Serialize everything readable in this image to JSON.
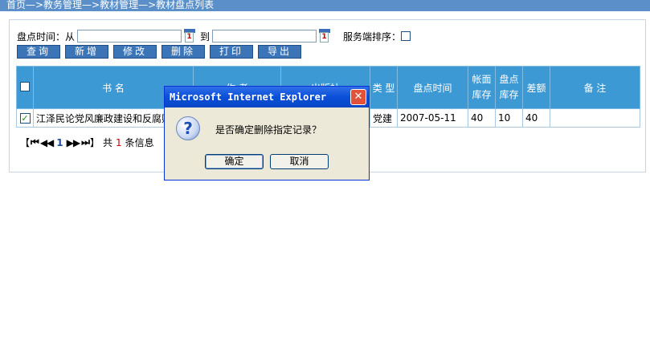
{
  "breadcrumb": "首页—>教务管理—>教材管理—>教材盘点列表",
  "search": {
    "time_label": "盘点时间：从",
    "from_value": "",
    "to_label": "到",
    "to_value": "",
    "server_sort_label": "服务端排序：",
    "calendar_icon_text": "1"
  },
  "toolbar": {
    "query": "查询",
    "add": "新增",
    "edit": "修改",
    "delete": "删除",
    "print": "打印",
    "export": "导出"
  },
  "table": {
    "headers": {
      "name": "书 名",
      "author": "作 者",
      "publisher": "出版社",
      "type": "类 型",
      "check_time": "盘点时间",
      "book_stock_1": "帐面",
      "book_stock_2": "库存",
      "check_stock_1": "盘点",
      "check_stock_2": "库存",
      "diff": "差额",
      "remark": "备 注"
    },
    "rows": [
      {
        "name": "江泽民论党风廉政建设和反腐败",
        "author": "",
        "publisher": "",
        "type": "党建",
        "check_time": "2007-05-11",
        "book_stock": "40",
        "check_stock": "10",
        "diff": "40",
        "remark": ""
      }
    ]
  },
  "pager": {
    "open_bracket": "【",
    "first": "⏮",
    "prev": "◀◀",
    "page": "1",
    "next": "▶▶",
    "last": "⏭",
    "close_bracket": "】",
    "total_prefix": "共",
    "total_count": "1",
    "total_suffix": "条信息"
  },
  "dialog": {
    "title": "Microsoft Internet Explorer",
    "message": "是否确定删除指定记录？",
    "ok": "确定",
    "cancel": "取消",
    "icon": "?",
    "close_symbol": "✕"
  }
}
